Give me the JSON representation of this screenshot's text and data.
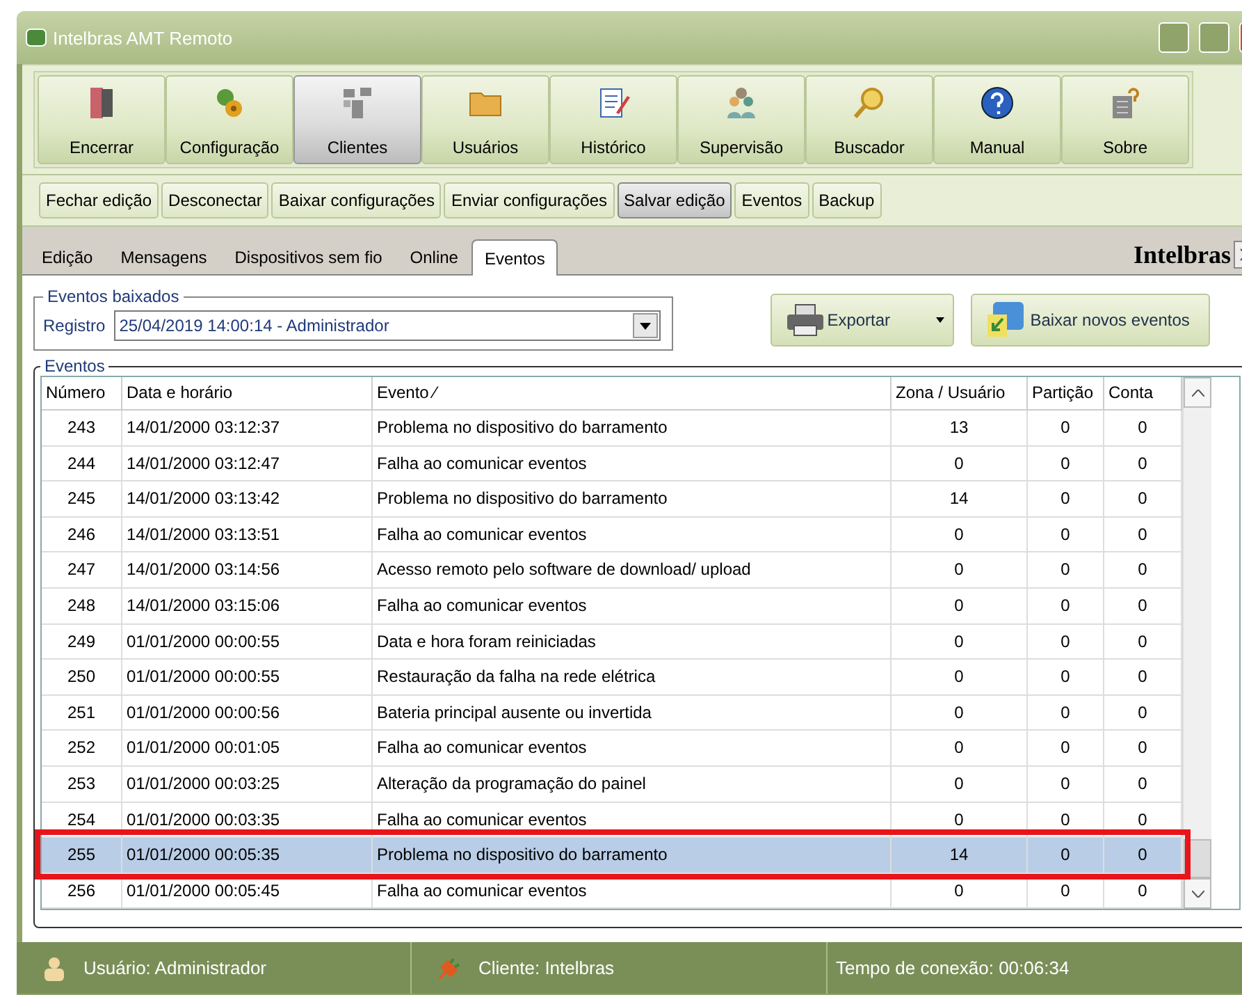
{
  "window": {
    "title": "Intelbras AMT Remoto"
  },
  "toolbar": [
    {
      "label": "Encerrar",
      "selected": false
    },
    {
      "label": "Configuração",
      "selected": false
    },
    {
      "label": "Clientes",
      "selected": true
    },
    {
      "label": "Usuários",
      "selected": false
    },
    {
      "label": "Histórico",
      "selected": false
    },
    {
      "label": "Supervisão",
      "selected": false
    },
    {
      "label": "Buscador",
      "selected": false
    },
    {
      "label": "Manual",
      "selected": false
    },
    {
      "label": "Sobre",
      "selected": false
    }
  ],
  "actions": [
    {
      "label": "Fechar edição",
      "selected": false
    },
    {
      "label": "Desconectar",
      "selected": false
    },
    {
      "label": "Baixar configurações",
      "selected": false
    },
    {
      "label": "Enviar configurações",
      "selected": false
    },
    {
      "label": "Salvar edição",
      "selected": true
    },
    {
      "label": "Eventos",
      "selected": false
    },
    {
      "label": "Backup",
      "selected": false
    }
  ],
  "tabs": [
    {
      "label": "Edição",
      "selected": false
    },
    {
      "label": "Mensagens",
      "selected": false
    },
    {
      "label": "Dispositivos sem fio",
      "selected": false
    },
    {
      "label": "Online",
      "selected": false
    },
    {
      "label": "Eventos",
      "selected": true
    }
  ],
  "brand": "Intelbras",
  "downloaded": {
    "title": "Eventos baixados",
    "label": "Registro",
    "value": "25/04/2019 14:00:14 - Administrador"
  },
  "buttons": [
    {
      "label": "Exportar",
      "kind": "dropdown"
    },
    {
      "label": "Baixar novos eventos",
      "kind": "plain"
    }
  ],
  "events": {
    "title": "Eventos",
    "columns": [
      "Número",
      "Data e horário",
      "Evento ⁄",
      "Zona / Usuário",
      "Partição",
      "Conta"
    ],
    "rows": [
      {
        "cells": [
          "243",
          "14/01/2000 03:12:37",
          "Problema no dispositivo do barramento",
          "13",
          "0",
          "0"
        ],
        "selected": false
      },
      {
        "cells": [
          "244",
          "14/01/2000 03:12:47",
          "Falha ao comunicar eventos",
          "0",
          "0",
          "0"
        ],
        "selected": false
      },
      {
        "cells": [
          "245",
          "14/01/2000 03:13:42",
          "Problema no dispositivo do barramento",
          "14",
          "0",
          "0"
        ],
        "selected": false
      },
      {
        "cells": [
          "246",
          "14/01/2000 03:13:51",
          "Falha ao comunicar eventos",
          "0",
          "0",
          "0"
        ],
        "selected": false
      },
      {
        "cells": [
          "247",
          "14/01/2000 03:14:56",
          "Acesso remoto pelo software de download/ upload",
          "0",
          "0",
          "0"
        ],
        "selected": false
      },
      {
        "cells": [
          "248",
          "14/01/2000 03:15:06",
          "Falha ao comunicar eventos",
          "0",
          "0",
          "0"
        ],
        "selected": false
      },
      {
        "cells": [
          "249",
          "01/01/2000 00:00:55",
          "Data e hora foram reiniciadas",
          "0",
          "0",
          "0"
        ],
        "selected": false
      },
      {
        "cells": [
          "250",
          "01/01/2000 00:00:55",
          "Restauração da falha na rede elétrica",
          "0",
          "0",
          "0"
        ],
        "selected": false
      },
      {
        "cells": [
          "251",
          "01/01/2000 00:00:56",
          "Bateria principal ausente ou invertida",
          "0",
          "0",
          "0"
        ],
        "selected": false
      },
      {
        "cells": [
          "252",
          "01/01/2000 00:01:05",
          "Falha ao comunicar eventos",
          "0",
          "0",
          "0"
        ],
        "selected": false
      },
      {
        "cells": [
          "253",
          "01/01/2000 00:03:25",
          "Alteração da programação do painel",
          "0",
          "0",
          "0"
        ],
        "selected": false
      },
      {
        "cells": [
          "254",
          "01/01/2000 00:03:35",
          "Falha ao comunicar eventos",
          "0",
          "0",
          "0"
        ],
        "selected": false
      },
      {
        "cells": [
          "255",
          "01/01/2000 00:05:35",
          "Problema no dispositivo do barramento",
          "14",
          "0",
          "0"
        ],
        "selected": true
      },
      {
        "cells": [
          "256",
          "01/01/2000 00:05:45",
          "Falha ao comunicar eventos",
          "0",
          "0",
          "0"
        ],
        "selected": false
      }
    ]
  },
  "status_bar": {
    "user": "Usuário: Administrador",
    "client": "Cliente: Intelbras",
    "time": "Tempo de conexão: 00:06:34"
  }
}
